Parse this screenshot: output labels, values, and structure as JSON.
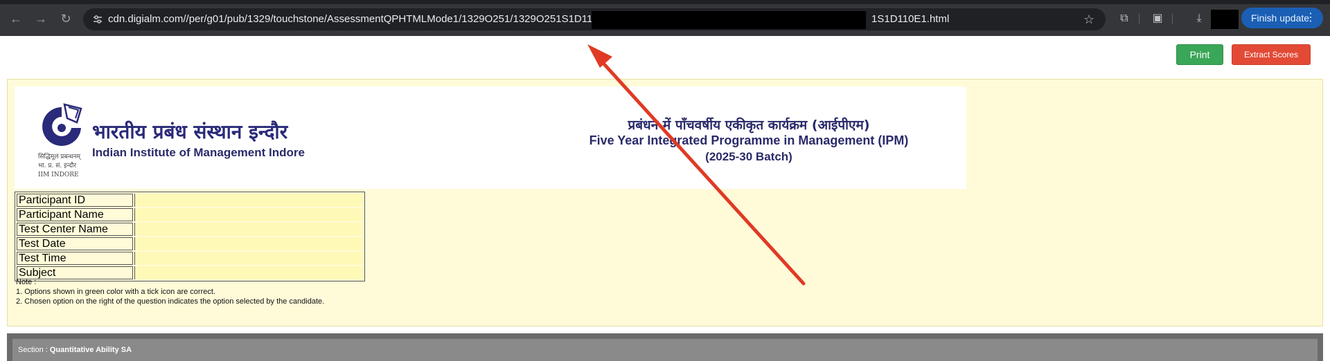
{
  "browser": {
    "url_visible": "cdn.digialm.com//per/g01/pub/1329/touchstone/AssessmentQPHTMLMode1/1329O251/1329O251S1D110/",
    "url_tail": "1S1D110E1.html",
    "finish_update_label": "Finish update",
    "menu_glyph": "⋮"
  },
  "toolbar": {
    "print_label": "Print",
    "extract_label": "Extract Scores"
  },
  "header": {
    "institute_hindi": "भारतीय प्रबंध संस्थान इन्दौर",
    "institute_english": "Indian Institute of Management Indore",
    "logo_line1": "सिद्धिमूलं प्रबन्धनम्",
    "logo_line2": "भा. प्र. सं. इन्दौर",
    "logo_line3": "IIM INDORE",
    "program_hindi": "प्रबंधन में पाँचवर्षीय एकीकृत कार्यक्रम (आईपीएम)",
    "program_english": "Five Year Integrated Programme in Management (IPM)",
    "batch": "(2025-30 Batch)"
  },
  "info_table": {
    "rows": [
      {
        "label": "Participant ID",
        "value": ""
      },
      {
        "label": "Participant Name",
        "value": ""
      },
      {
        "label": "Test Center Name",
        "value": ""
      },
      {
        "label": "Test Date",
        "value": ""
      },
      {
        "label": "Test Time",
        "value": ""
      },
      {
        "label": "Subject",
        "value": ""
      }
    ]
  },
  "note": {
    "title": "Note :",
    "line1": "1. Options shown in green color with a tick icon are correct.",
    "line2": "2. Chosen option on the right of the question indicates the option selected by the candidate."
  },
  "section": {
    "prefix": "Section : ",
    "name": "Quantitative Ability SA"
  },
  "colors": {
    "print": "#3aa657",
    "extract": "#e24a36",
    "panel": "#fffbd9",
    "arrow": "#e03a24"
  }
}
